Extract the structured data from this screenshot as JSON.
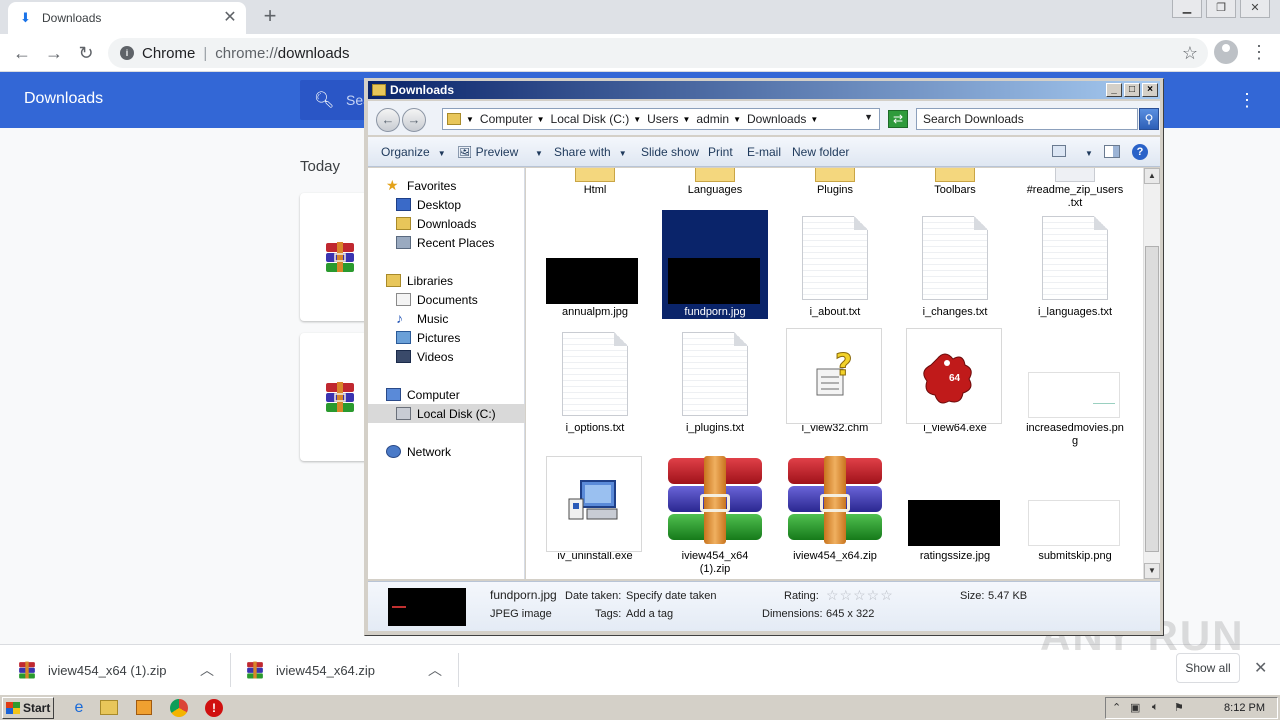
{
  "browser": {
    "tab_title": "Downloads",
    "omnibox": {
      "origin_label": "Chrome",
      "scheme": "chrome://",
      "path": "downloads"
    }
  },
  "downloads_page": {
    "title": "Downloads",
    "search_placeholder": "Sea",
    "section": "Today"
  },
  "shelf": {
    "items": [
      {
        "name": "iview454_x64 (1).zip"
      },
      {
        "name": "iview454_x64.zip"
      }
    ],
    "show_all": "Show all"
  },
  "explorer": {
    "title": "Downloads",
    "breadcrumbs": [
      "Computer",
      "Local Disk (C:)",
      "Users",
      "admin",
      "Downloads"
    ],
    "search_placeholder": "Search Downloads",
    "commands": {
      "organize": "Organize",
      "preview": "Preview",
      "share_with": "Share with",
      "slide_show": "Slide show",
      "print": "Print",
      "email": "E-mail",
      "new_folder": "New folder"
    },
    "nav": {
      "favorites": "Favorites",
      "desktop": "Desktop",
      "downloads": "Downloads",
      "recent_places": "Recent Places",
      "libraries": "Libraries",
      "documents": "Documents",
      "music": "Music",
      "pictures": "Pictures",
      "videos": "Videos",
      "computer": "Computer",
      "local_disk": "Local Disk (C:)",
      "network": "Network"
    },
    "files": {
      "row0": [
        "Html",
        "Languages",
        "Plugins",
        "Toolbars",
        "#readme_zip_users",
        ".txt"
      ],
      "annualpm": "annualpm.jpg",
      "fundporn": "fundporn.jpg",
      "i_about": "i_about.txt",
      "i_changes": "i_changes.txt",
      "i_languages": "i_languages.txt",
      "i_options": "i_options.txt",
      "i_plugins": "i_plugins.txt",
      "i_view32": "i_view32.chm",
      "i_view64": "i_view64.exe",
      "increasedmovies_1": "increasedmovies.pn",
      "increasedmovies_2": "g",
      "iv_uninstall": "iv_uninstall.exe",
      "iview1_1": "iview454_x64",
      "iview1_2": "(1).zip",
      "iview2": "iview454_x64.zip",
      "ratingssize": "ratingssize.jpg",
      "submitskip": "submitskip.png",
      "exe_badge": "64"
    },
    "details": {
      "filename": "fundporn.jpg",
      "type": "JPEG image",
      "date_taken_label": "Date taken:",
      "date_taken_value": "Specify date taken",
      "tags_label": "Tags:",
      "tags_value": "Add a tag",
      "rating_label": "Rating:",
      "rating_value": 0,
      "dimensions_label": "Dimensions:",
      "dimensions_value": "645 x 322",
      "size_label": "Size:",
      "size_value": "5.47 KB"
    }
  },
  "taskbar": {
    "start": "Start",
    "clock": "8:12 PM"
  },
  "watermark": "ANY RUN"
}
